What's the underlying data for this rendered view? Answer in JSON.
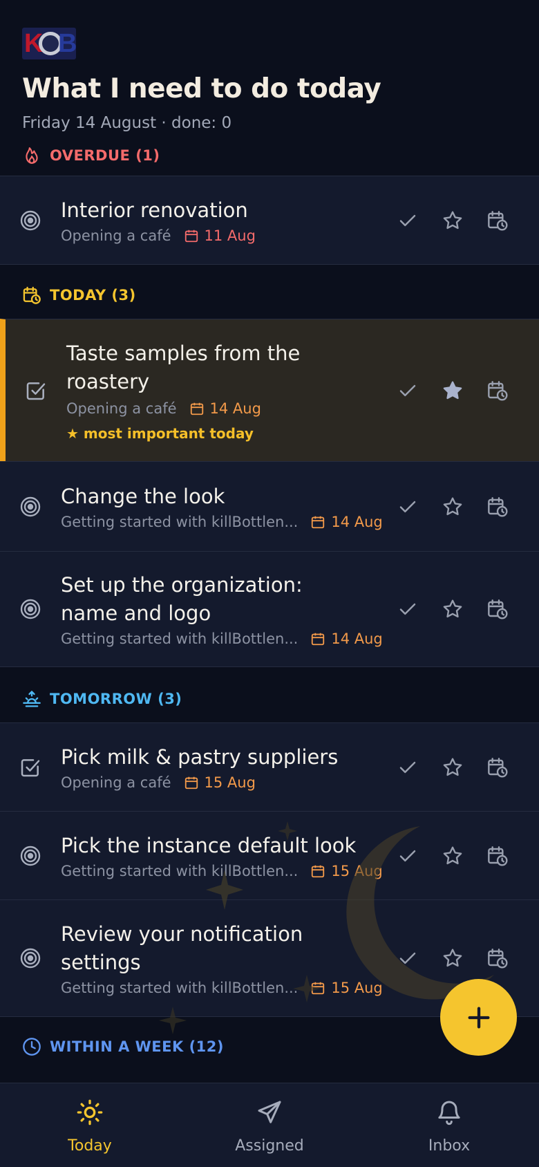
{
  "app": {
    "logo_text": "KOB",
    "title": "What I need to do today",
    "subtitle": "Friday 14 August · done: 0"
  },
  "colors": {
    "overdue": "#f46b6b",
    "today": "#f5c52e",
    "tomorrow": "#4fb8f2",
    "week": "#5f95f0",
    "due_orange": "#f39a4a",
    "accent": "#f5c52e"
  },
  "sections": {
    "overdue": {
      "label": "OVERDUE (1)",
      "icon": "flame-icon",
      "tasks": [
        {
          "title": "Interior renovation",
          "project": "Opening a café",
          "due": "11 Aug",
          "type_icon": "target-icon",
          "starred": false
        }
      ]
    },
    "today": {
      "label": "TODAY (3)",
      "icon": "calendar-clock-icon",
      "tasks": [
        {
          "title": "Taste samples from the roastery",
          "project": "Opening a café",
          "due": "14 Aug",
          "type_icon": "checkbox-icon",
          "starred": true,
          "note": "★ most important today"
        },
        {
          "title": "Change the look",
          "project": "Getting started with killBottlen...",
          "due": "14 Aug",
          "type_icon": "target-icon",
          "starred": false
        },
        {
          "title": "Set up the organization: name and logo",
          "project": "Getting started with killBottlen...",
          "due": "14 Aug",
          "type_icon": "target-icon",
          "starred": false
        }
      ]
    },
    "tomorrow": {
      "label": "TOMORROW (3)",
      "icon": "sunrise-icon",
      "tasks": [
        {
          "title": "Pick milk & pastry suppliers",
          "project": "Opening a café",
          "due": "15 Aug",
          "type_icon": "checkbox-icon",
          "starred": false
        },
        {
          "title": "Pick the instance default look",
          "project": "Getting started with killBottlen...",
          "due": "15 Aug",
          "type_icon": "target-icon",
          "starred": false
        },
        {
          "title": "Review your notification settings",
          "project": "Getting started with killBottlen...",
          "due": "15 Aug",
          "type_icon": "target-icon",
          "starred": false
        }
      ]
    },
    "week": {
      "label": "WITHIN A WEEK (12)",
      "icon": "clock-icon"
    }
  },
  "nav": {
    "items": [
      {
        "label": "Today",
        "icon": "sun-icon",
        "active": true
      },
      {
        "label": "Assigned",
        "icon": "send-icon",
        "active": false
      },
      {
        "label": "Inbox",
        "icon": "bell-icon",
        "active": false
      }
    ]
  }
}
